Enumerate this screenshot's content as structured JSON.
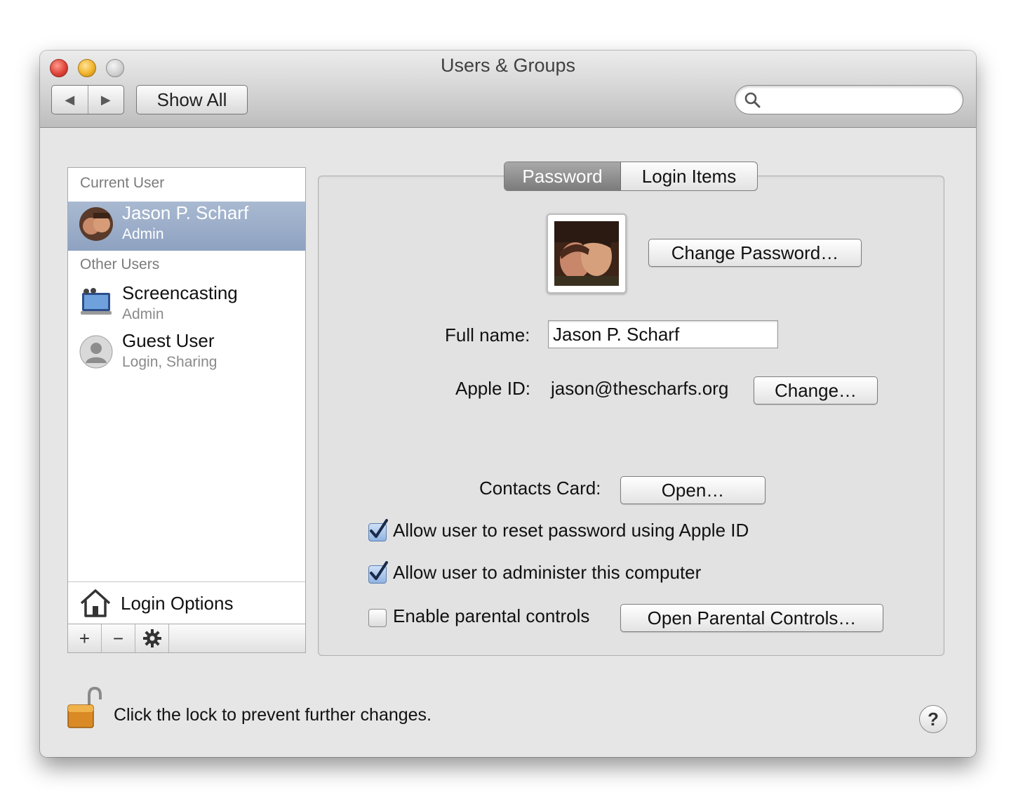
{
  "window": {
    "title": "Users & Groups",
    "back_icon": "back-arrow-icon",
    "forward_icon": "forward-arrow-icon",
    "show_all_label": "Show All",
    "search_placeholder": "",
    "search_value": ""
  },
  "sidebar": {
    "current_user_header": "Current User",
    "current_user": {
      "name": "Jason P. Scharf",
      "role": "Admin",
      "avatar": "user-photo"
    },
    "other_users_header": "Other Users",
    "other_users": [
      {
        "name": "Screencasting",
        "role": "Admin",
        "avatar": "screencasting-icon"
      },
      {
        "name": "Guest User",
        "role": "Login, Sharing",
        "avatar": "guest-user-icon"
      }
    ],
    "login_options_label": "Login Options",
    "toolbar": {
      "add": "+",
      "remove": "−",
      "gear": "gear-icon"
    }
  },
  "tabs": [
    {
      "label": "Password",
      "active": true
    },
    {
      "label": "Login Items",
      "active": false
    }
  ],
  "password_tab": {
    "change_password_label": "Change Password…",
    "full_name_label": "Full name:",
    "full_name_value": "Jason P. Scharf",
    "apple_id_label": "Apple ID:",
    "apple_id_value": "jason@thescharfs.org",
    "change_label": "Change…",
    "contacts_card_label": "Contacts Card:",
    "open_label": "Open…",
    "options": [
      {
        "label": "Allow user to reset password using Apple ID",
        "checked": true
      },
      {
        "label": "Allow user to administer this computer",
        "checked": true
      },
      {
        "label": "Enable parental controls",
        "checked": false
      }
    ],
    "open_parental_controls_label": "Open Parental Controls…"
  },
  "footer": {
    "lock_text": "Click the lock to prevent further changes.",
    "lock_state": "unlocked",
    "help_label": "?"
  },
  "colors": {
    "selection": "#9aabc8",
    "checkbox_checked": "#8fb3e2",
    "panel_bg": "#e2e2e2"
  }
}
